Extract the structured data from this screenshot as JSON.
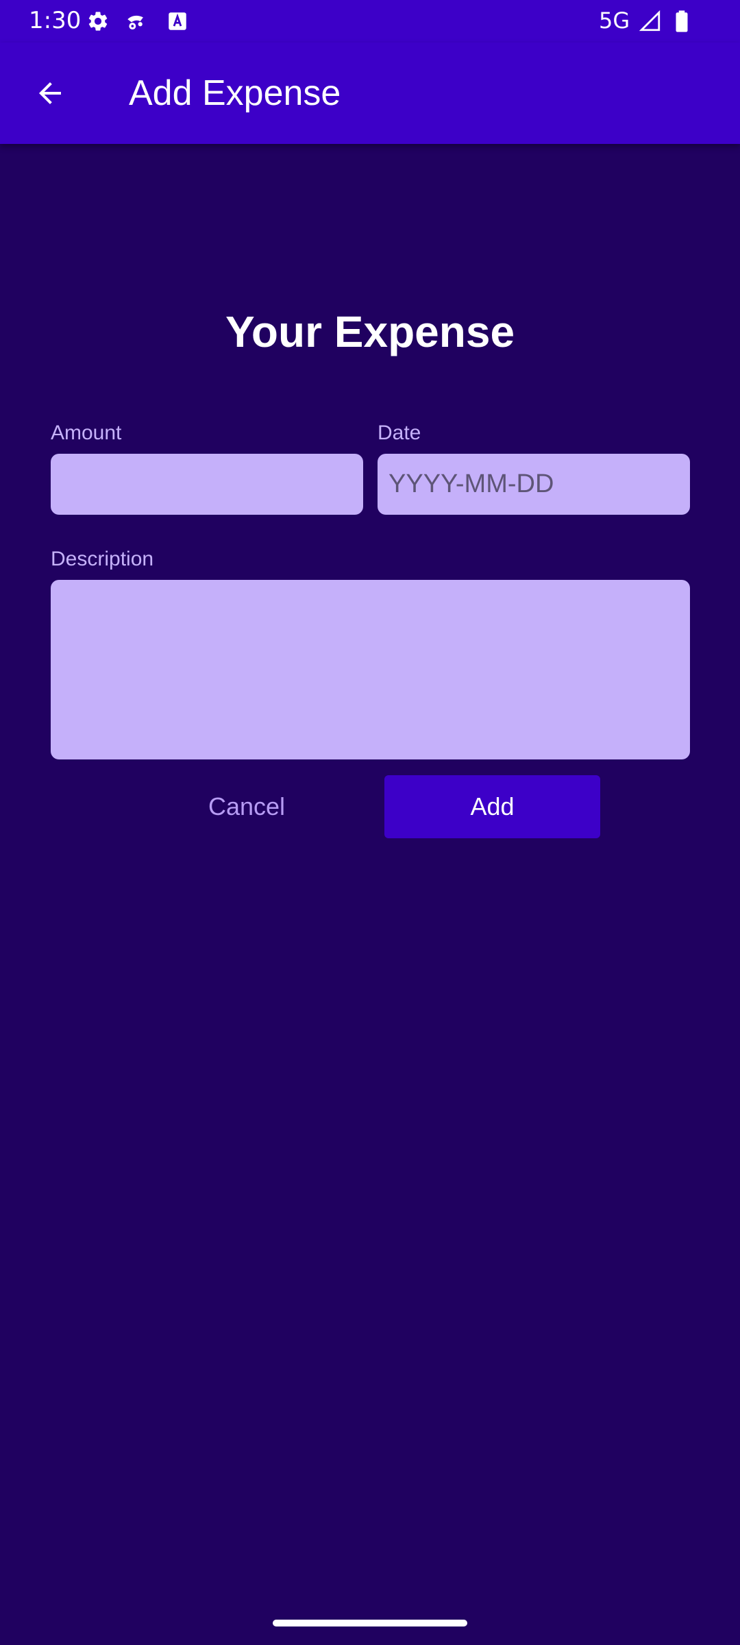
{
  "status_bar": {
    "time": "1:30",
    "network": "5G",
    "icons": [
      "settings-icon",
      "cast-icon",
      "a-box-icon",
      "signal-icon",
      "battery-icon"
    ]
  },
  "app_bar": {
    "title": "Add Expense",
    "back_icon": "arrow-back-icon"
  },
  "form": {
    "heading": "Your Expense",
    "amount": {
      "label": "Amount",
      "value": "",
      "placeholder": ""
    },
    "date": {
      "label": "Date",
      "value": "",
      "placeholder": "YYYY-MM-DD"
    },
    "description": {
      "label": "Description",
      "value": "",
      "placeholder": ""
    },
    "cancel_label": "Cancel",
    "add_label": "Add"
  },
  "colors": {
    "app_bar": "#3D00C8",
    "background": "#200160",
    "input_fill": "#C5B0FA",
    "label_text": "#C6B2FA",
    "cancel_text": "#B79CF4",
    "add_button": "#3D00C8"
  }
}
